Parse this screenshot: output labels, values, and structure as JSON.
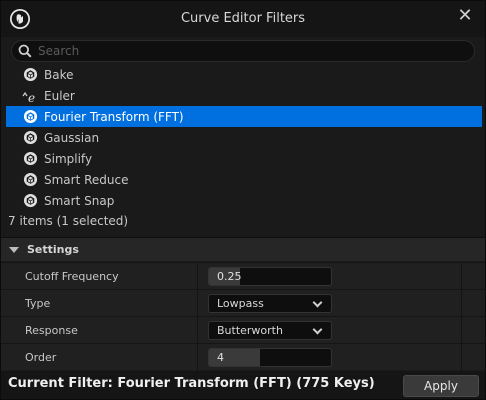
{
  "window": {
    "title": "Curve Editor Filters",
    "close_icon": "close-icon"
  },
  "search": {
    "placeholder": "Search",
    "value": ""
  },
  "list": {
    "items": [
      {
        "label": "Bake",
        "icon": "unreal-cube-icon",
        "selected": false
      },
      {
        "label": "Euler",
        "icon": "euler-icon",
        "selected": false
      },
      {
        "label": "Fourier Transform (FFT)",
        "icon": "unreal-cube-icon",
        "selected": true
      },
      {
        "label": "Gaussian",
        "icon": "unreal-cube-icon",
        "selected": false
      },
      {
        "label": "Simplify",
        "icon": "unreal-cube-icon",
        "selected": false
      },
      {
        "label": "Smart Reduce",
        "icon": "unreal-cube-icon",
        "selected": false
      },
      {
        "label": "Smart Snap",
        "icon": "unreal-cube-icon",
        "selected": false
      }
    ],
    "count_text": "7 items (1 selected)"
  },
  "settings": {
    "header": "Settings",
    "cutoff_frequency": {
      "label": "Cutoff Frequency",
      "value": "0.25",
      "fill_fraction": 0.25
    },
    "type": {
      "label": "Type",
      "value": "Lowpass"
    },
    "response": {
      "label": "Response",
      "value": "Butterworth"
    },
    "order": {
      "label": "Order",
      "value": "4",
      "fill_fraction": 0.42
    }
  },
  "footer": {
    "current_filter": "Current Filter: Fourier Transform (FFT) (775 Keys)",
    "apply_label": "Apply"
  },
  "colors": {
    "selection": "#0070e0",
    "background": "#1a1a1a"
  }
}
